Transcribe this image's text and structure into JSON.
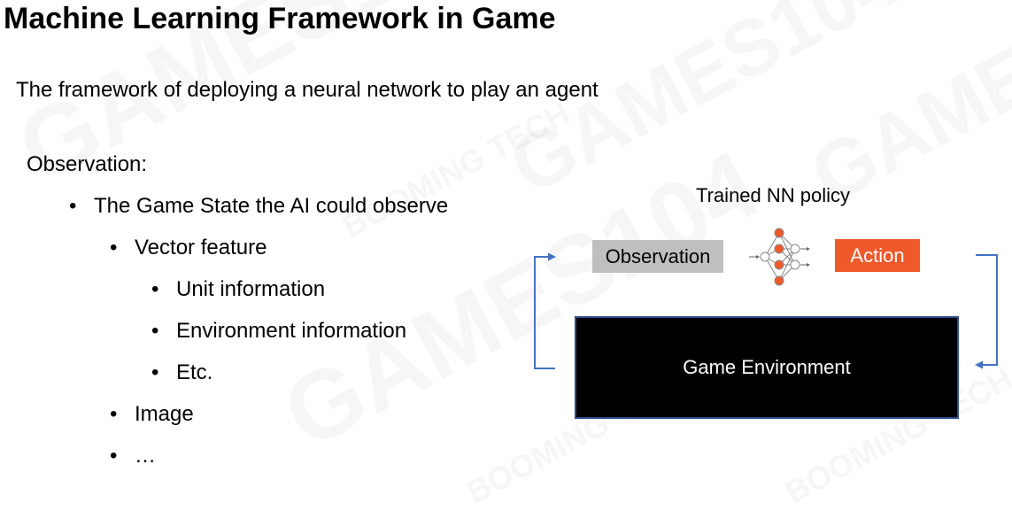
{
  "slide": {
    "title": "Machine Learning Framework in Game",
    "subtitle": "The framework of deploying a neural network to play an agent",
    "observation_heading": "Observation:",
    "bullets": {
      "marker": "•",
      "game_state": "The Game State the AI could observe",
      "vector_feature": "Vector feature",
      "unit_info": "Unit information",
      "env_info": "Environment information",
      "etc": "Etc.",
      "image": "Image",
      "ellipsis": "…"
    }
  },
  "diagram": {
    "policy_caption": "Trained NN policy",
    "observation_label": "Observation",
    "action_label": "Action",
    "environment_label": "Game Environment",
    "colors": {
      "observation_box": "#bfbfbf",
      "action_box": "#f0592a",
      "environment_box": "#000000",
      "arrow": "#4472c4",
      "nn_node": "#f0592a"
    }
  },
  "watermark": {
    "text_1": "GAMES104",
    "text_2": "BOOMING TECH"
  }
}
